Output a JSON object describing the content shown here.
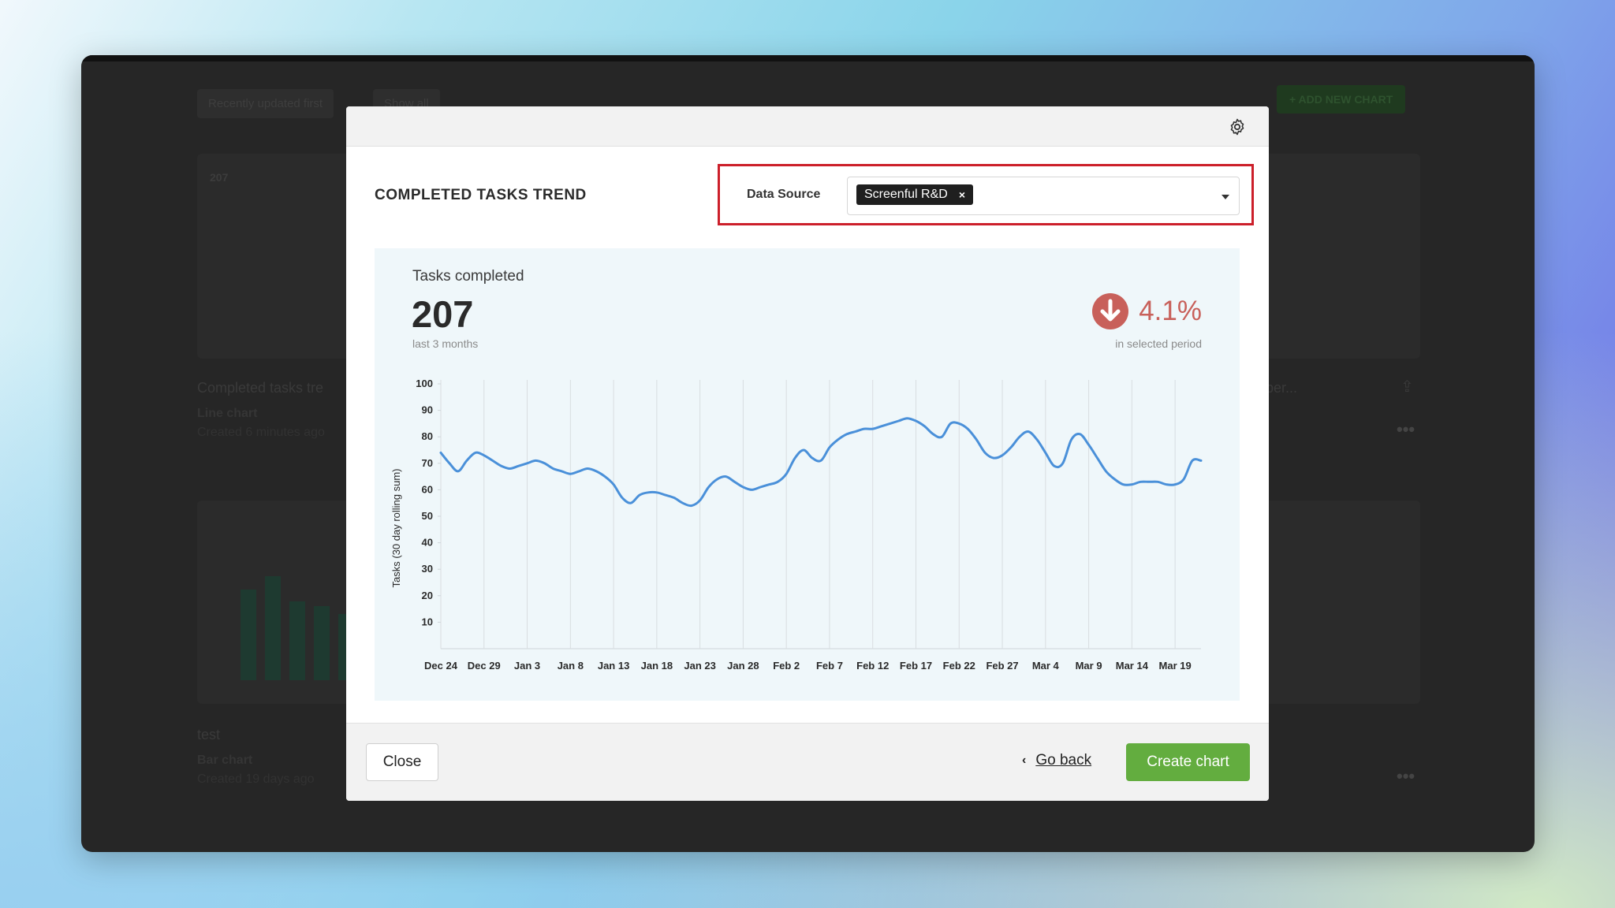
{
  "background": {
    "sort_label": "Recently updated first",
    "filter_label": "Show all",
    "add_button": "+ ADD NEW CHART",
    "mini_value": "207",
    "cards": [
      {
        "title": "Completed tasks tre",
        "type": "Line chart",
        "meta": "Created 6 minutes ago"
      },
      {
        "title": "test",
        "type": "Bar chart",
        "meta": "Created 19 days ago"
      }
    ],
    "right_title": "per..."
  },
  "modal": {
    "title": "COMPLETED TASKS TREND",
    "data_source": {
      "label": "Data Source",
      "selected": "Screenful R&D",
      "remove": "×"
    },
    "metric": {
      "label": "Tasks completed",
      "value": "207",
      "period": "last 3 months",
      "change": "4.1%",
      "change_period": "in selected period"
    },
    "footer": {
      "close": "Close",
      "go_back": "Go back",
      "create": "Create chart"
    }
  },
  "colors": {
    "accent_green": "#63ad3f",
    "highlight_red": "#cc1f2a",
    "line_blue": "#4a90d9",
    "down_red": "#c8605a"
  },
  "chart_data": {
    "type": "line",
    "ylabel": "Tasks (30 day rolling sum)",
    "ylim": [
      0,
      100
    ],
    "yticks": [
      10,
      20,
      30,
      40,
      50,
      60,
      70,
      80,
      90,
      100
    ],
    "xticks": [
      "Dec 24",
      "Dec 29",
      "Jan 3",
      "Jan 8",
      "Jan 13",
      "Jan 18",
      "Jan 23",
      "Jan 28",
      "Feb 2",
      "Feb 7",
      "Feb 12",
      "Feb 17",
      "Feb 22",
      "Feb 27",
      "Mar 4",
      "Mar 9",
      "Mar 14",
      "Mar 19"
    ],
    "grid": true,
    "series": [
      {
        "x": [
          "Dec 24",
          "Dec 25",
          "Dec 26",
          "Dec 27",
          "Dec 28",
          "Dec 29",
          "Dec 30",
          "Dec 31",
          "Jan 1",
          "Jan 2",
          "Jan 3",
          "Jan 4",
          "Jan 5",
          "Jan 6",
          "Jan 7",
          "Jan 8",
          "Jan 9",
          "Jan 10",
          "Jan 11",
          "Jan 12",
          "Jan 13",
          "Jan 14",
          "Jan 15",
          "Jan 16",
          "Jan 17",
          "Jan 18",
          "Jan 19",
          "Jan 20",
          "Jan 21",
          "Jan 22",
          "Jan 23",
          "Jan 24",
          "Jan 25",
          "Jan 26",
          "Jan 27",
          "Jan 28",
          "Jan 29",
          "Jan 30",
          "Jan 31",
          "Feb 1",
          "Feb 2",
          "Feb 3",
          "Feb 4",
          "Feb 5",
          "Feb 6",
          "Feb 7",
          "Feb 8",
          "Feb 9",
          "Feb 10",
          "Feb 11",
          "Feb 12",
          "Feb 13",
          "Feb 14",
          "Feb 15",
          "Feb 16",
          "Feb 17",
          "Feb 18",
          "Feb 19",
          "Feb 20",
          "Feb 21",
          "Feb 22",
          "Feb 23",
          "Feb 24",
          "Feb 25",
          "Feb 26",
          "Feb 27",
          "Feb 28",
          "Mar 1",
          "Mar 2",
          "Mar 3",
          "Mar 4",
          "Mar 5",
          "Mar 6",
          "Mar 7",
          "Mar 8",
          "Mar 9",
          "Mar 10",
          "Mar 11",
          "Mar 12",
          "Mar 13",
          "Mar 14",
          "Mar 15",
          "Mar 16",
          "Mar 17",
          "Mar 18",
          "Mar 19",
          "Mar 20",
          "Mar 21",
          "Mar 22"
        ],
        "values": [
          74,
          70,
          67,
          71,
          74,
          73,
          71,
          69,
          68,
          69,
          70,
          71,
          70,
          68,
          67,
          66,
          67,
          68,
          67,
          65,
          62,
          57,
          55,
          58,
          59,
          59,
          58,
          57,
          55,
          54,
          56,
          61,
          64,
          65,
          63,
          61,
          60,
          61,
          62,
          63,
          66,
          72,
          75,
          72,
          71,
          76,
          79,
          81,
          82,
          83,
          83,
          84,
          85,
          86,
          87,
          86,
          84,
          81,
          80,
          85,
          85,
          83,
          79,
          74,
          72,
          73,
          76,
          80,
          82,
          79,
          74,
          69,
          70,
          79,
          81,
          77,
          72,
          67,
          64,
          62,
          62,
          63,
          63,
          63,
          62,
          62,
          64,
          71,
          71
        ]
      }
    ]
  }
}
